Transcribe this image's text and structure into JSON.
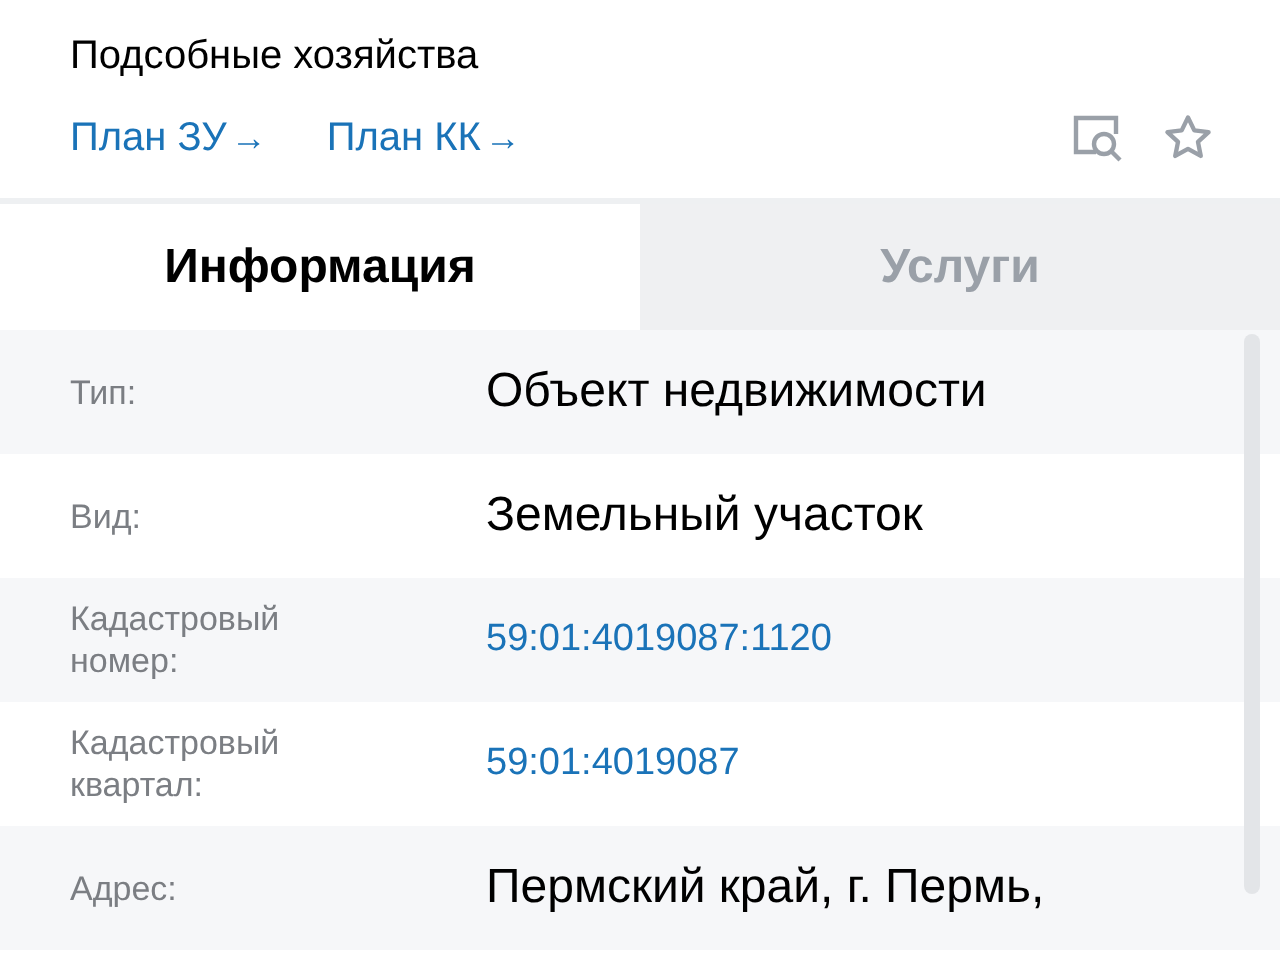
{
  "header": {
    "title": "Подсобные хозяйства",
    "links": [
      {
        "label": "План ЗУ",
        "arrow": "→"
      },
      {
        "label": "План КК",
        "arrow": "→"
      }
    ]
  },
  "tabs": [
    {
      "label": "Информация",
      "selected": true
    },
    {
      "label": "Услуги",
      "selected": false
    }
  ],
  "rows": [
    {
      "label": "Тип:",
      "value": "Объект недвижимости",
      "kind": "text"
    },
    {
      "label": "Вид:",
      "value": "Земельный участок",
      "kind": "text"
    },
    {
      "label": "Кадастровый номер:",
      "value": "59:01:4019087:1120",
      "kind": "link"
    },
    {
      "label": "Кадастровый квартал:",
      "value": "59:01:4019087",
      "kind": "link"
    },
    {
      "label": "Адрес:",
      "value": "Пермский край, г. Пермь,",
      "kind": "text"
    }
  ]
}
